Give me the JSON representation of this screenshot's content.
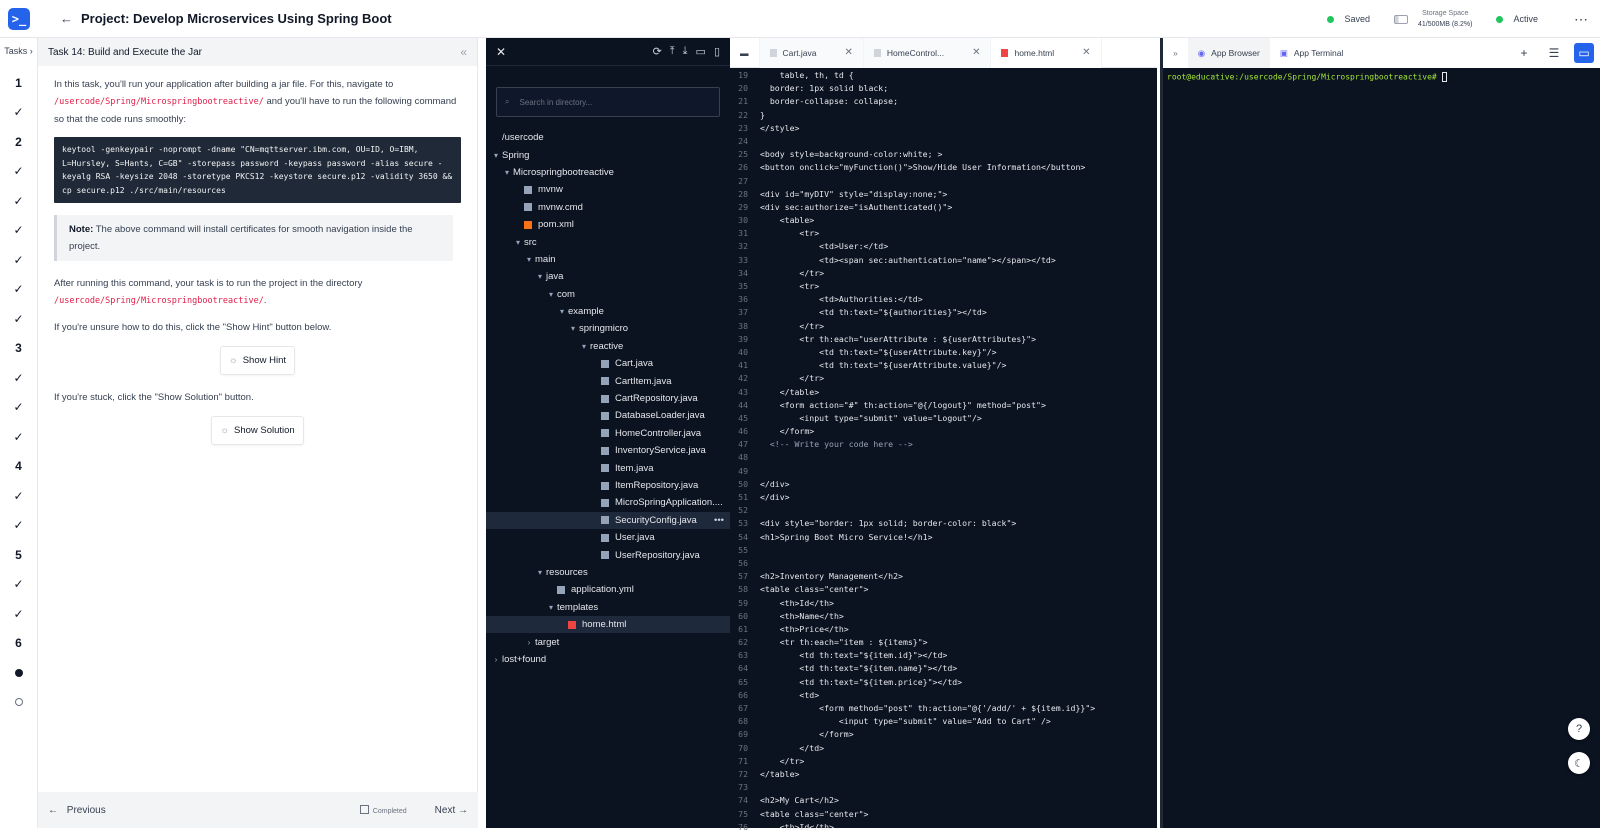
{
  "header": {
    "back": "←",
    "title": "Project: Develop Microservices Using Spring Boot",
    "saved": "Saved",
    "storage_label": "Storage Space",
    "storage_value": "41/500MB (8.2%)",
    "active": "Active",
    "more": "⋯",
    "accent": "#2563eb"
  },
  "rail": {
    "header": "Tasks",
    "items": [
      "1",
      "✓",
      "2",
      "✓",
      "✓",
      "✓",
      "✓",
      "✓",
      "✓",
      "3",
      "✓",
      "✓",
      "✓",
      "4",
      "✓",
      "✓",
      "5",
      "✓",
      "✓",
      "6",
      "",
      ""
    ]
  },
  "task": {
    "title": "Task 14: Build and Execute the Jar",
    "collapse": "«",
    "p1a": "In this task, you'll run your application after building a jar file. For this, navigate to",
    "p1b": "/usercode/Spring/Microspringbootreactive/",
    "p1c": " and you'll have to run the following command so that the code runs smoothly:",
    "command": "keytool -genkeypair -noprompt -dname \"CN=mqttserver.ibm.com, OU=ID, O=IBM, L=Hursley, S=Hants, C=GB\" -storepass password -keypass password -alias secure -keyalg RSA -keysize 2048 -storetype PKCS12 -keystore secure.p12 -validity 3650 && cp secure.p12 ./src/main/resources",
    "note_label": "Note:",
    "note_text": " The above command will install certificates for smooth navigation inside the project.",
    "p2a": "After running this command, your task is to run the project in the directory",
    "p2b": "/usercode/Spring/Microspringbootreactive/",
    "p2c": ".",
    "p3": "If you're unsure how to do this, click the \"Show Hint\" button below.",
    "hint": "Show Hint",
    "p4": "If you're stuck, click the \"Show Solution\" button.",
    "solution": "Show Solution",
    "previous": "Previous",
    "completed": "Completed",
    "next": "Next"
  },
  "explorer": {
    "close": "✕",
    "search_placeholder": "Search in directory...",
    "nodes": [
      {
        "label": "/usercode",
        "depth": 0,
        "arrow": "",
        "type": "folder"
      },
      {
        "label": "Spring",
        "depth": 0,
        "arrow": "▾",
        "type": "folder"
      },
      {
        "label": "Microspringbootreactive",
        "depth": 1,
        "arrow": "▾",
        "type": "folder"
      },
      {
        "label": "mvnw",
        "depth": 2,
        "arrow": "",
        "type": "file"
      },
      {
        "label": "mvnw.cmd",
        "depth": 2,
        "arrow": "",
        "type": "file"
      },
      {
        "label": "pom.xml",
        "depth": 2,
        "arrow": "",
        "type": "xml"
      },
      {
        "label": "src",
        "depth": 2,
        "arrow": "▾",
        "type": "folder"
      },
      {
        "label": "main",
        "depth": 3,
        "arrow": "▾",
        "type": "folder"
      },
      {
        "label": "java",
        "depth": 4,
        "arrow": "▾",
        "type": "folder"
      },
      {
        "label": "com",
        "depth": 5,
        "arrow": "▾",
        "type": "folder"
      },
      {
        "label": "example",
        "depth": 6,
        "arrow": "▾",
        "type": "folder"
      },
      {
        "label": "springmicro",
        "depth": 7,
        "arrow": "▾",
        "type": "folder"
      },
      {
        "label": "reactive",
        "depth": 8,
        "arrow": "▾",
        "type": "folder"
      },
      {
        "label": "Cart.java",
        "depth": 9,
        "arrow": "",
        "type": "file"
      },
      {
        "label": "CartItem.java",
        "depth": 9,
        "arrow": "",
        "type": "file"
      },
      {
        "label": "CartRepository.java",
        "depth": 9,
        "arrow": "",
        "type": "file"
      },
      {
        "label": "DatabaseLoader.java",
        "depth": 9,
        "arrow": "",
        "type": "file"
      },
      {
        "label": "HomeController.java",
        "depth": 9,
        "arrow": "",
        "type": "file"
      },
      {
        "label": "InventoryService.java",
        "depth": 9,
        "arrow": "",
        "type": "file"
      },
      {
        "label": "Item.java",
        "depth": 9,
        "arrow": "",
        "type": "file"
      },
      {
        "label": "ItemRepository.java",
        "depth": 9,
        "arrow": "",
        "type": "file"
      },
      {
        "label": "MicroSpringApplication....",
        "depth": 9,
        "arrow": "",
        "type": "file"
      },
      {
        "label": "SecurityConfig.java",
        "depth": 9,
        "arrow": "",
        "type": "file",
        "selected": true,
        "more": "•••"
      },
      {
        "label": "User.java",
        "depth": 9,
        "arrow": "",
        "type": "file"
      },
      {
        "label": "UserRepository.java",
        "depth": 9,
        "arrow": "",
        "type": "file"
      },
      {
        "label": "resources",
        "depth": 4,
        "arrow": "▾",
        "type": "folder"
      },
      {
        "label": "application.yml",
        "depth": 5,
        "arrow": "",
        "type": "file"
      },
      {
        "label": "templates",
        "depth": 5,
        "arrow": "▾",
        "type": "folder"
      },
      {
        "label": "home.html",
        "depth": 6,
        "arrow": "",
        "type": "html",
        "selected": true
      },
      {
        "label": "target",
        "depth": 3,
        "arrow": "›",
        "type": "folder"
      },
      {
        "label": "lost+found",
        "depth": 0,
        "arrow": "›",
        "type": "folder"
      }
    ]
  },
  "editor": {
    "tabs": [
      {
        "label": "Cart.java",
        "active": false
      },
      {
        "label": "HomeControl...",
        "active": false
      },
      {
        "label": "home.html",
        "active": true
      }
    ],
    "lines": [
      {
        "n": "19",
        "t": "    table, th, td {"
      },
      {
        "n": "20",
        "t": "  border: 1px solid black;"
      },
      {
        "n": "21",
        "t": "  border-collapse: collapse;"
      },
      {
        "n": "22",
        "t": "}"
      },
      {
        "n": "23",
        "t": "</style>"
      },
      {
        "n": "24",
        "t": ""
      },
      {
        "n": "25",
        "t": "<body style=background-color:white; >"
      },
      {
        "n": "26",
        "t": "<button onclick=\"myFunction()\">Show/Hide User Information</button>"
      },
      {
        "n": "27",
        "t": ""
      },
      {
        "n": "28",
        "t": "<div id=\"myDIV\" style=\"display:none;\">"
      },
      {
        "n": "29",
        "t": "<div sec:authorize=\"isAuthenticated()\">"
      },
      {
        "n": "30",
        "t": "    <table>"
      },
      {
        "n": "31",
        "t": "        <tr>"
      },
      {
        "n": "32",
        "t": "            <td>User:</td>"
      },
      {
        "n": "33",
        "t": "            <td><span sec:authentication=\"name\"></span></td>"
      },
      {
        "n": "34",
        "t": "        </tr>"
      },
      {
        "n": "35",
        "t": "        <tr>"
      },
      {
        "n": "36",
        "t": "            <td>Authorities:</td>"
      },
      {
        "n": "37",
        "t": "            <td th:text=\"${authorities}\"></td>"
      },
      {
        "n": "38",
        "t": "        </tr>"
      },
      {
        "n": "39",
        "t": "        <tr th:each=\"userAttribute : ${userAttributes}\">"
      },
      {
        "n": "40",
        "t": "            <td th:text=\"${userAttribute.key}\"/>"
      },
      {
        "n": "41",
        "t": "            <td th:text=\"${userAttribute.value}\"/>"
      },
      {
        "n": "42",
        "t": "        </tr>"
      },
      {
        "n": "43",
        "t": "    </table>"
      },
      {
        "n": "44",
        "t": "    <form action=\"#\" th:action=\"@{/logout}\" method=\"post\">"
      },
      {
        "n": "45",
        "t": "        <input type=\"submit\" value=\"Logout\"/>"
      },
      {
        "n": "46",
        "t": "    </form>"
      },
      {
        "n": "47",
        "t": "  <!-- Write your code here -->"
      },
      {
        "n": "48",
        "t": ""
      },
      {
        "n": "49",
        "t": ""
      },
      {
        "n": "50",
        "t": "</div>"
      },
      {
        "n": "51",
        "t": "</div>"
      },
      {
        "n": "52",
        "t": ""
      },
      {
        "n": "53",
        "t": "<div style=\"border: 1px solid; border-color: black\">"
      },
      {
        "n": "54",
        "t": "<h1>Spring Boot Micro Service!</h1>"
      },
      {
        "n": "55",
        "t": ""
      },
      {
        "n": "56",
        "t": ""
      },
      {
        "n": "57",
        "t": "<h2>Inventory Management</h2>"
      },
      {
        "n": "58",
        "t": "<table class=\"center\">"
      },
      {
        "n": "59",
        "t": "    <th>Id</th>"
      },
      {
        "n": "60",
        "t": "    <th>Name</th>"
      },
      {
        "n": "61",
        "t": "    <th>Price</th>"
      },
      {
        "n": "62",
        "t": "    <tr th:each=\"item : ${items}\">"
      },
      {
        "n": "63",
        "t": "        <td th:text=\"${item.id}\"></td>"
      },
      {
        "n": "64",
        "t": "        <td th:text=\"${item.name}\"></td>"
      },
      {
        "n": "65",
        "t": "        <td th:text=\"${item.price}\"></td>"
      },
      {
        "n": "66",
        "t": "        <td>"
      },
      {
        "n": "67",
        "t": "            <form method=\"post\" th:action=\"@{'/add/' + ${item.id}}\">"
      },
      {
        "n": "68",
        "t": "                <input type=\"submit\" value=\"Add to Cart\" />"
      },
      {
        "n": "69",
        "t": "            </form>"
      },
      {
        "n": "70",
        "t": "        </td>"
      },
      {
        "n": "71",
        "t": "    </tr>"
      },
      {
        "n": "72",
        "t": "</table>"
      },
      {
        "n": "73",
        "t": ""
      },
      {
        "n": "74",
        "t": "<h2>My Cart</h2>"
      },
      {
        "n": "75",
        "t": "<table class=\"center\">"
      },
      {
        "n": "76",
        "t": "    <th>Id</th>"
      }
    ]
  },
  "right_panel": {
    "collapse": "»",
    "tab_browser": "App Browser",
    "tab_terminal": "App Terminal",
    "prompt": "root@educative:/usercode/Spring/Microspringbootreactive#",
    "help": "?",
    "theme": "☾"
  }
}
